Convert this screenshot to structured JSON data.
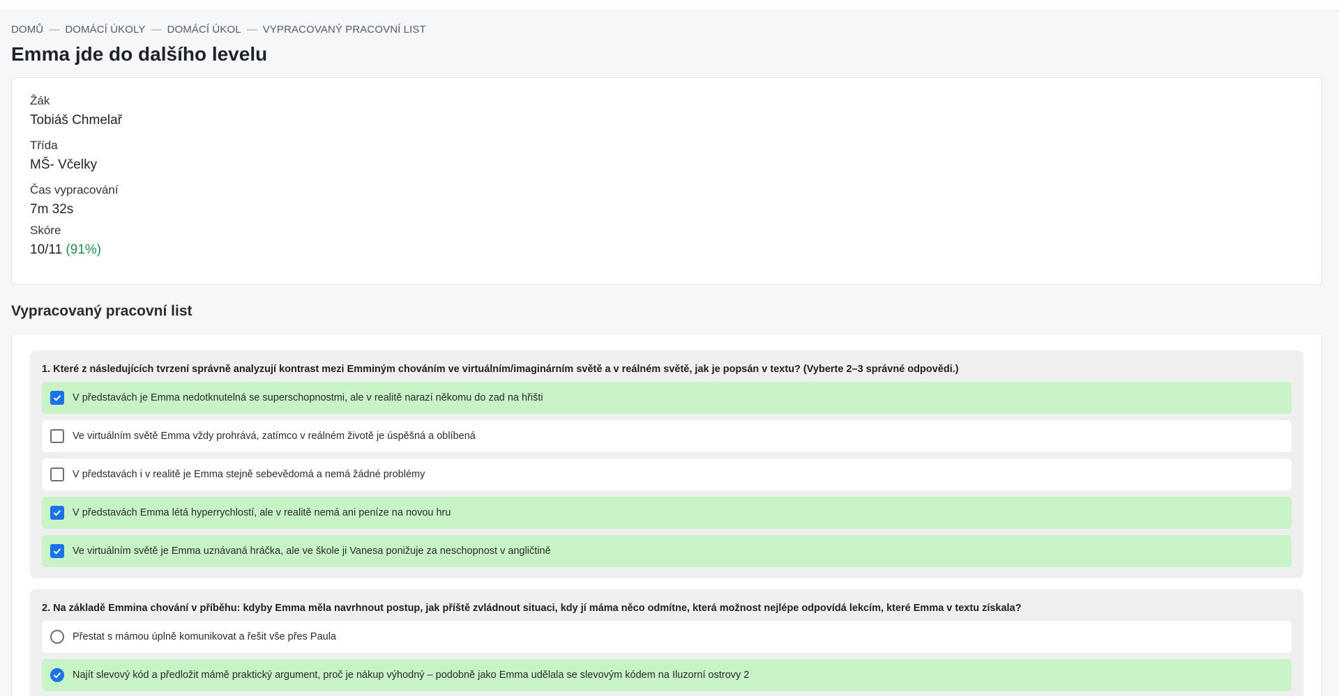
{
  "breadcrumb": [
    "DOMŮ",
    "DOMÁCÍ ÚKOLY",
    "DOMÁCÍ ÚKOL",
    "VYPRACOVANÝ PRACOVNÍ LIST"
  ],
  "breadcrumb_separator": "—",
  "title": "Emma jde do dalšího levelu",
  "info": {
    "student_label": "Žák",
    "student": "Tobiáš Chmelař",
    "class_label": "Třída",
    "class": "MŠ- Včelky",
    "time_label": "Čas vypracování",
    "time": "7m 32s",
    "score_label": "Skóre",
    "score": "10/11",
    "score_pct": "(91%)"
  },
  "section_title": "Vypracovaný pracovní list",
  "questions": [
    {
      "text": "1.  Které z následujících tvrzení správně analyzují kontrast mezi Emminým chováním ve virtuálním/imaginárním světě a v reálném světě, jak je popsán v textu? (Vyberte 2–3 správné odpovědi.)",
      "options": [
        {
          "text": "V představách je Emma nedotknutelná se superschopnostmi, ale v realitě narazí někomu do zad na hřišti",
          "checked": true
        },
        {
          "text": "Ve virtuálním světě Emma vždy prohrává, zatímco v reálném životě je úspěšná a oblíbená",
          "checked": false
        },
        {
          "text": "V představách i v realitě je Emma stejně sebevědomá a nemá žádné problémy",
          "checked": false
        },
        {
          "text": "V představách Emma létá hyperrychlostí, ale v realitě nemá ani peníze na novou hru",
          "checked": true
        },
        {
          "text": "Ve virtuálním světě je Emma uznávaná hráčka, ale ve škole ji Vanesa ponižuje za neschopnost v angličtině",
          "checked": true
        }
      ]
    },
    {
      "text": "2.  Na základě Emmina chování v příběhu: kdyby Emma měla navrhnout postup, jak příště zvládnout situaci, kdy jí máma něco odmítne, která možnost nejlépe odpovídá lekcím, které Emma v textu získala?",
      "options": [
        {
          "text": "Přestat s mámou úplně komunikovat a řešit vše přes Paula",
          "checked": false
        },
        {
          "text": "Najít slevový kód a předložit mámě praktický argument, proč je nákup výhodný – podobně jako Emma udělala se slevovým kódem na Iluzorní ostrovy 2",
          "checked": true
        }
      ]
    }
  ]
}
